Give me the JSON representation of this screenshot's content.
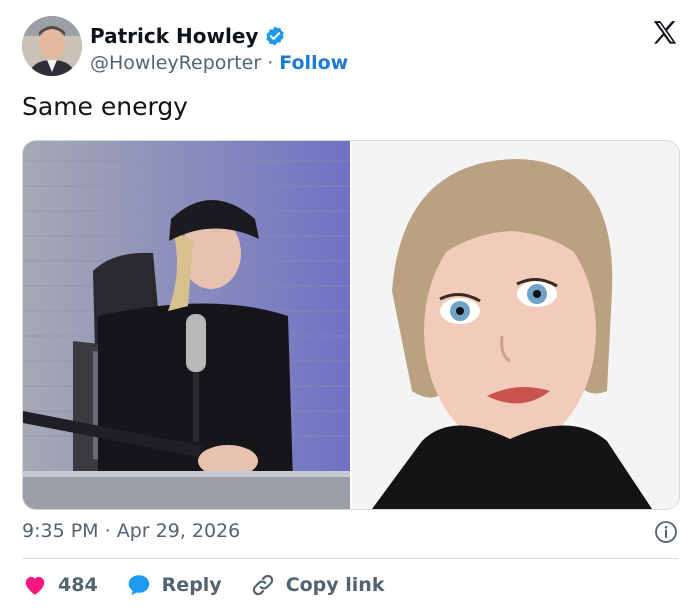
{
  "tweet": {
    "author_name": "Patrick Howley",
    "handle": "@HowleyReporter",
    "separator": "·",
    "follow_label": "Follow",
    "text": "Same energy",
    "time": "9:35 PM",
    "date": "Apr 29, 2026"
  },
  "actions": {
    "like_count": "484",
    "reply_label": "Reply",
    "copy_link_label": "Copy link"
  },
  "colors": {
    "link_blue": "#1d7bd8",
    "verified_blue": "#1d9bf0",
    "like_red": "#f91880",
    "text_gray": "#536471"
  },
  "icons": [
    "verified-badge-icon",
    "x-logo-icon",
    "info-icon",
    "heart-icon",
    "reply-bubble-icon",
    "link-icon"
  ]
}
